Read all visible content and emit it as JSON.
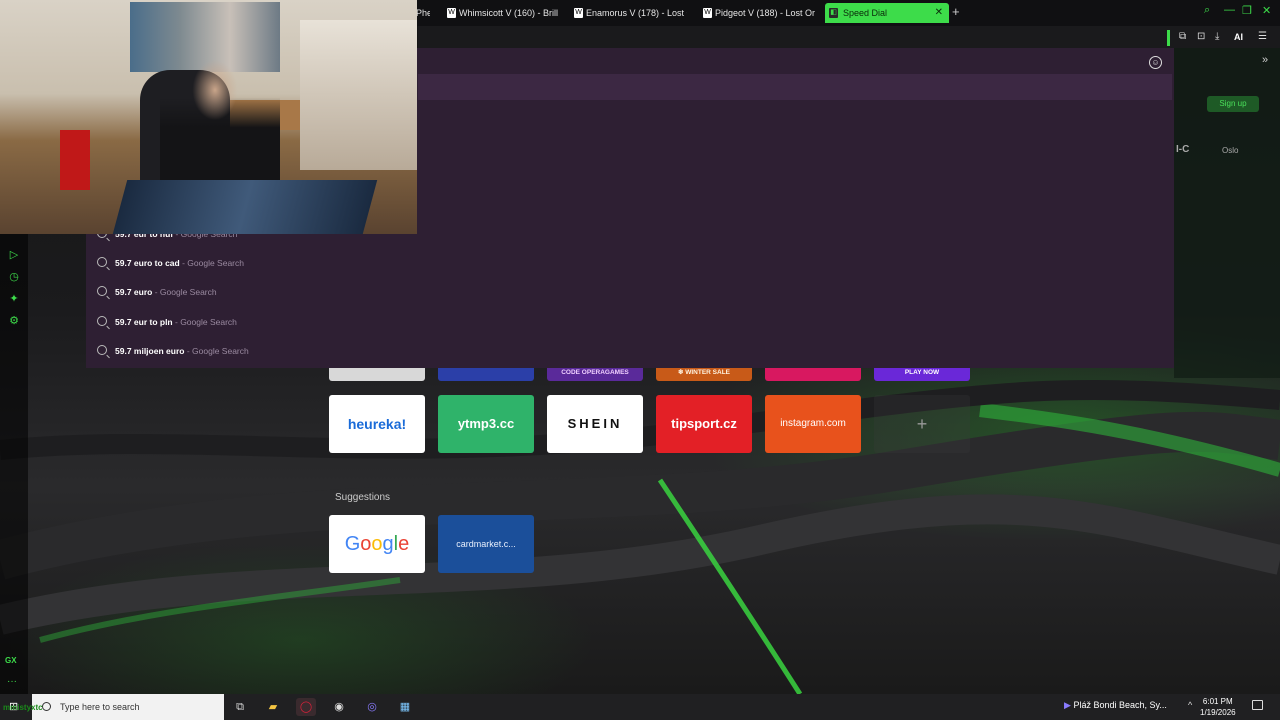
{
  "browser": {
    "tabs": [
      {
        "label": "Phe"
      },
      {
        "label": "Whimsicott V (160) - Brillia"
      },
      {
        "label": "Enamorus V (178) - Lost O"
      },
      {
        "label": "Pidgeot V (188) - Lost Orig"
      },
      {
        "label": "Speed Dial",
        "active": true
      }
    ],
    "ai_label": "AI"
  },
  "search_suggestions": [
    {
      "query": "59.7 eur to huf",
      "source": "- Google Search"
    },
    {
      "query": "59.7 euro to cad",
      "source": "- Google Search"
    },
    {
      "query": "59.7 euro",
      "source": "- Google Search"
    },
    {
      "query": "59.7 eur to pln",
      "source": "- Google Search"
    },
    {
      "query": "59.7 miljoen euro",
      "source": "- Google Search"
    }
  ],
  "speed_dial": {
    "top_row_strips": [
      {
        "label": "",
        "color": "#d8d8d8"
      },
      {
        "label": "",
        "color": "#2b3fa8"
      },
      {
        "label": "CODE OPERAGAMES",
        "color": "#5a2a9a"
      },
      {
        "label": "❄ WINTER SALE",
        "color": "#c85a18"
      },
      {
        "label": "",
        "color": "#d81860"
      },
      {
        "label": "PLAY NOW",
        "color": "#6a28d8"
      }
    ],
    "tiles": [
      {
        "label": "heureka!",
        "bg": "#ffffff",
        "fg": "#1a6bd8"
      },
      {
        "label": "ytmp3.cc",
        "bg": "#2fb36a",
        "fg": "#ffffff"
      },
      {
        "label": "SHEIN",
        "bg": "#ffffff",
        "fg": "#111111"
      },
      {
        "label": "tipsport.cz",
        "bg": "#e32026",
        "fg": "#ffffff"
      },
      {
        "label": "instagram.com",
        "bg": "#e8521c",
        "fg": "#ffffff"
      }
    ],
    "add_label": "+",
    "suggestions_title": "Suggestions",
    "suggestions": [
      {
        "label": "Google",
        "bg": "#ffffff"
      },
      {
        "label": "cardmarket.c...",
        "bg": "#1b4f9a",
        "fg": "#e6eefc"
      }
    ]
  },
  "right_panel": {
    "signup_label": "Sign up",
    "label_1": "I-C",
    "label_2": "Oslo"
  },
  "taskbar": {
    "search_placeholder": "Type here to search",
    "overlay_text": "mmistyxtc",
    "weather": "Pláž Bondi Beach, Sy...",
    "time": "6:01 PM",
    "date": "1/19/2026"
  }
}
